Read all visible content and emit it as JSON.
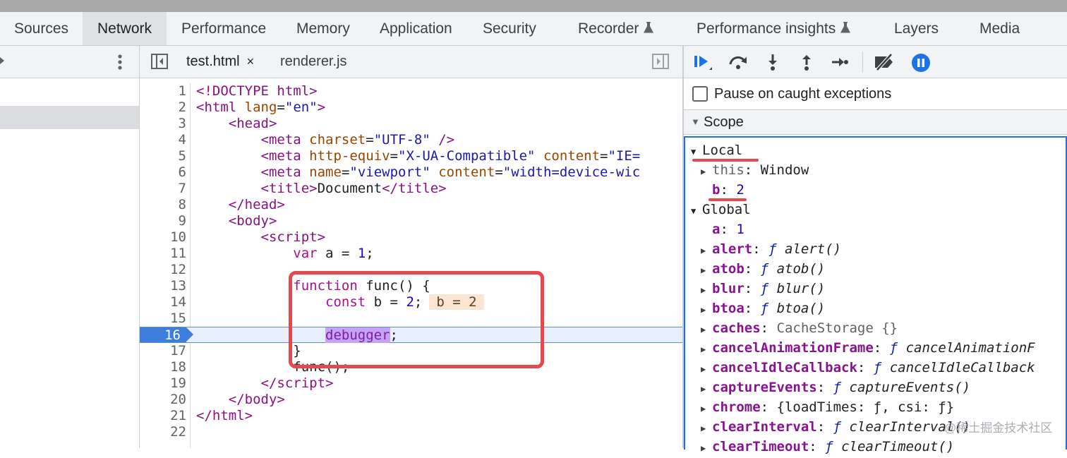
{
  "tabs": [
    {
      "label": "Sources",
      "active": false
    },
    {
      "label": "Network",
      "active": true
    },
    {
      "label": "Performance",
      "active": false
    },
    {
      "label": "Memory",
      "active": false
    },
    {
      "label": "Application",
      "active": false
    },
    {
      "label": "Security",
      "active": false
    },
    {
      "label": "Recorder",
      "active": false,
      "flask": true
    },
    {
      "label": "Performance insights",
      "active": false,
      "flask": true
    },
    {
      "label": "Layers",
      "active": false
    },
    {
      "label": "Media",
      "active": false
    }
  ],
  "editor": {
    "tabs": [
      {
        "label": "test.html",
        "active": true,
        "close": "×"
      },
      {
        "label": "renderer.js",
        "active": false
      }
    ],
    "line_numbers": [
      "1",
      "2",
      "3",
      "4",
      "5",
      "6",
      "7",
      "8",
      "9",
      "10",
      "11",
      "12",
      "13",
      "14",
      "15",
      "16",
      "17",
      "18",
      "19",
      "20",
      "21",
      "22"
    ],
    "paused_line": "16",
    "inline_value": "b = 2"
  },
  "debugger": {
    "pause_on_caught_label": "Pause on caught exceptions",
    "scope_label": "Scope",
    "local_label": "Local",
    "global_label": "Global",
    "local": [
      {
        "key": "this",
        "value": "Window",
        "expandable": true
      },
      {
        "key": "b",
        "value": "2",
        "expandable": false
      }
    ],
    "global": [
      {
        "key": "a",
        "value": "1",
        "type": "num",
        "expandable": false
      },
      {
        "key": "alert",
        "value": "alert()",
        "type": "fn",
        "expandable": true
      },
      {
        "key": "atob",
        "value": "atob()",
        "type": "fn",
        "expandable": true
      },
      {
        "key": "blur",
        "value": "blur()",
        "type": "fn",
        "expandable": true
      },
      {
        "key": "btoa",
        "value": "btoa()",
        "type": "fn",
        "expandable": true
      },
      {
        "key": "caches",
        "value": "CacheStorage {}",
        "type": "obj",
        "expandable": true
      },
      {
        "key": "cancelAnimationFrame",
        "value": "cancelAnimationF",
        "type": "fn",
        "expandable": true
      },
      {
        "key": "cancelIdleCallback",
        "value": "cancelIdleCallback",
        "type": "fn",
        "expandable": true
      },
      {
        "key": "captureEvents",
        "value": "captureEvents()",
        "type": "fn",
        "expandable": true
      },
      {
        "key": "chrome",
        "value": "{loadTimes: ƒ, csi: ƒ}",
        "type": "obj",
        "expandable": true
      },
      {
        "key": "clearInterval",
        "value": "clearInterval()",
        "type": "fn",
        "expandable": true
      },
      {
        "key": "clearTimeout",
        "value": "clearTimeout()",
        "type": "fn",
        "expandable": true
      }
    ]
  },
  "watermark": "@稀土掘金技术社区",
  "colors": {
    "accent": "#1a73e8",
    "highlight_box": "#e5484d",
    "breakpoint": "#3d7ddb"
  }
}
